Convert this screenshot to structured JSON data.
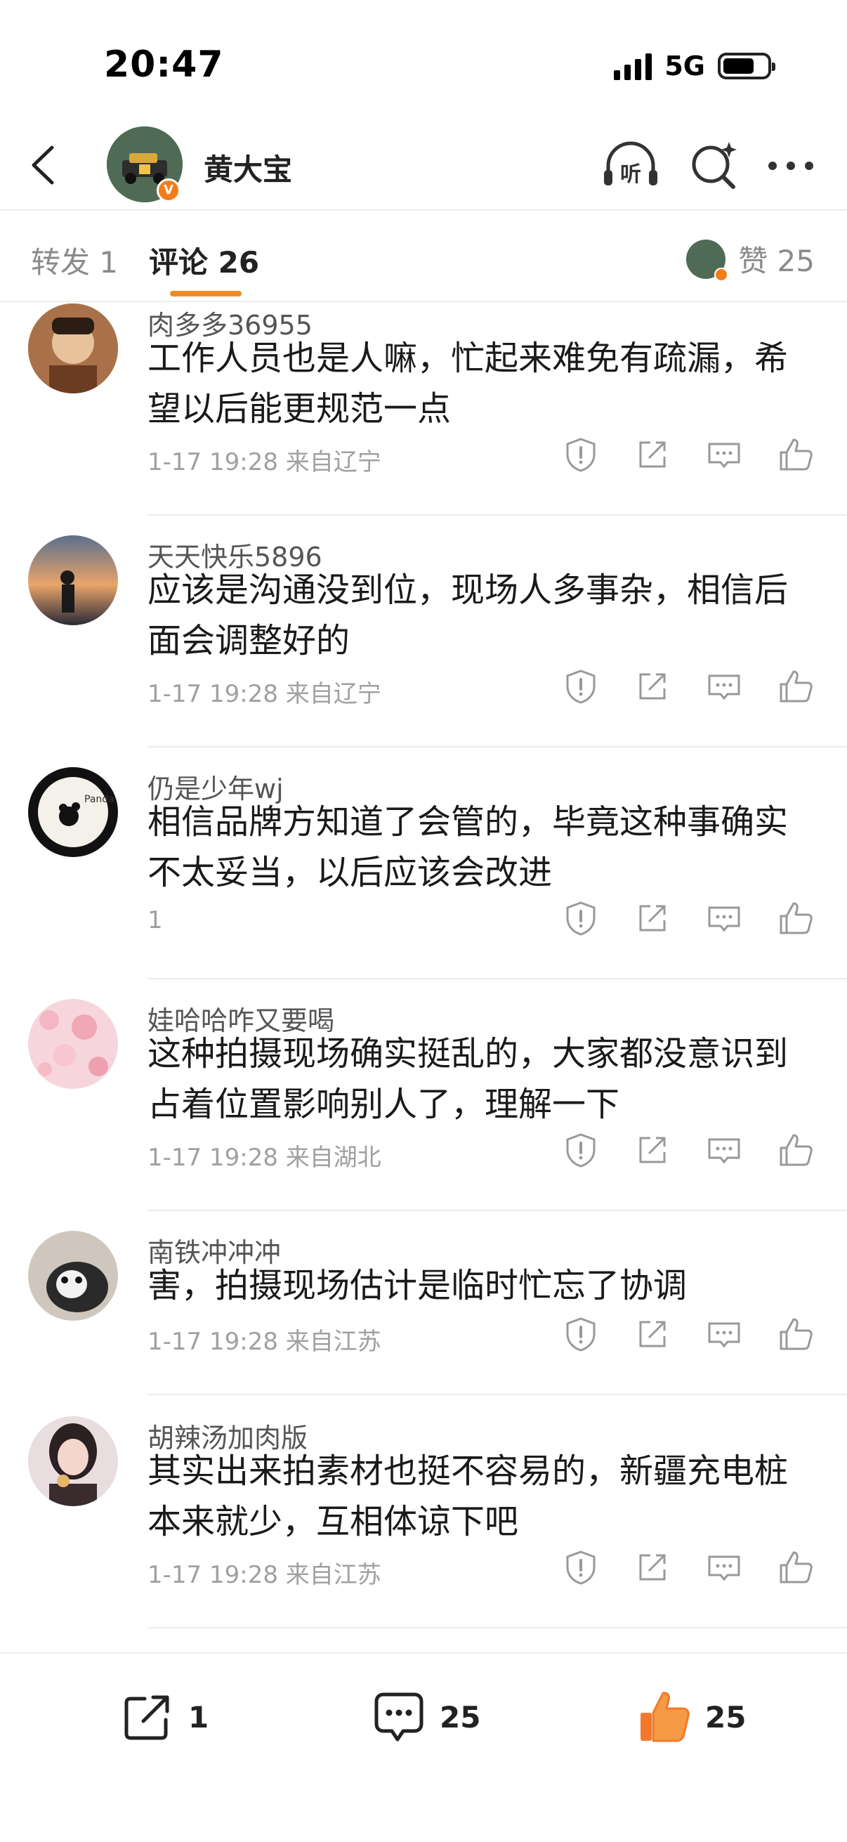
{
  "status_bar": {
    "time": "20:47",
    "network": "5G"
  },
  "header": {
    "title": "黄大宝",
    "verified_badge": "V"
  },
  "tabs": {
    "repost_label": "转发 1",
    "comment_label": "评论 26",
    "likes_label": "赞 25"
  },
  "comments": [
    {
      "username": "肉多多36955",
      "text": "工作人员也是人嘛，忙起来难免有疏漏，希望以后能更规范一点",
      "meta": "1-17 19:28 来自辽宁"
    },
    {
      "username": "天天快乐5896",
      "text": "应该是沟通没到位，现场人多事杂，相信后面会调整好的",
      "meta": "1-17 19:28 来自辽宁"
    },
    {
      "username": "仍是少年wj",
      "text": "相信品牌方知道了会管的，毕竟这种事确实不太妥当，以后应该会改进",
      "meta": "1"
    },
    {
      "username": "娃哈哈咋又要喝",
      "text": "这种拍摄现场确实挺乱的，大家都没意识到占着位置影响别人了，理解一下",
      "meta": "1-17 19:28 来自湖北"
    },
    {
      "username": "南铁冲冲冲",
      "text": "害，拍摄现场估计是临时忙忘了协调",
      "meta": "1-17 19:28 来自江苏"
    },
    {
      "username": "胡辣汤加肉版",
      "text": "其实出来拍素材也挺不容易的，新疆充电桩本来就少，互相体谅下吧",
      "meta": "1-17 19:28 来自江苏"
    }
  ],
  "bottom_bar": {
    "repost_count": "1",
    "comment_count": "25",
    "like_count": "25"
  },
  "colors": {
    "accent": "#f08a24",
    "like_orange": "#f07a2a",
    "muted": "#a0a0a0"
  },
  "icons": [
    "back-icon",
    "listen-icon",
    "ai-search-icon",
    "more-icon",
    "report-icon",
    "share-icon",
    "reply-icon",
    "like-icon"
  ]
}
